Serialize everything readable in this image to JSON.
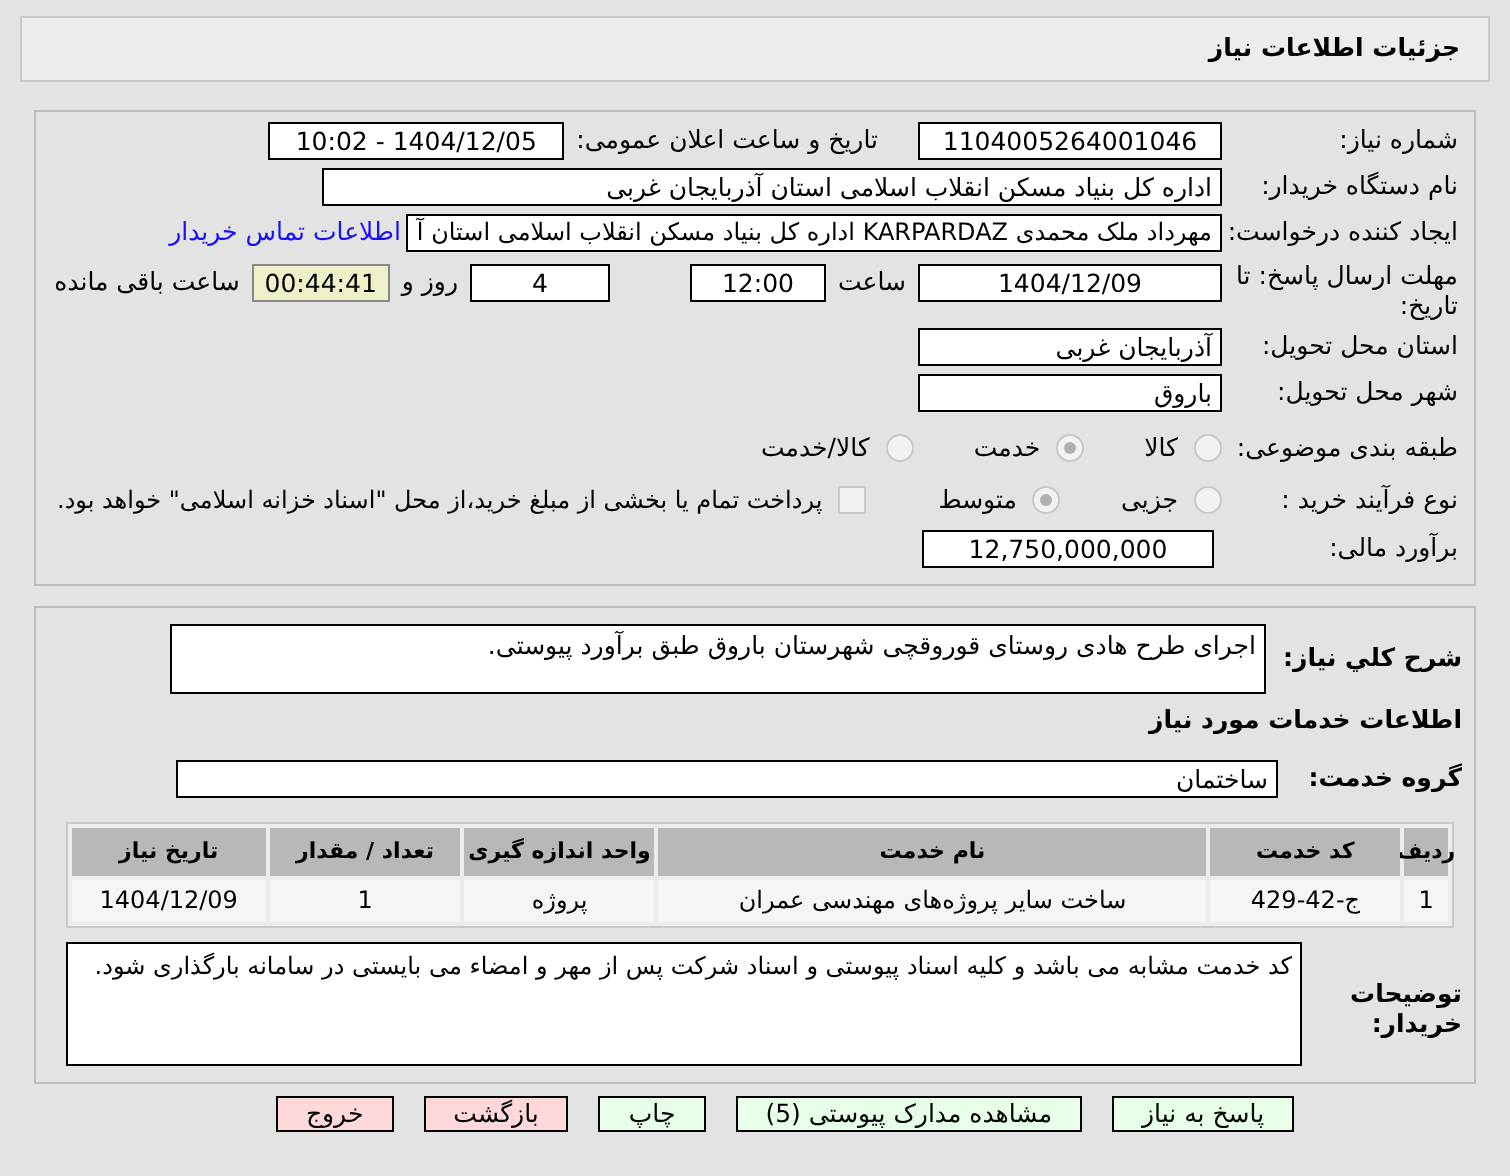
{
  "header": {
    "title": "جزئیات اطلاعات نیاز"
  },
  "fields": {
    "need_number": {
      "label": "شماره نیاز:",
      "value": "1104005264001046"
    },
    "announce": {
      "label": "تاریخ و ساعت اعلان عمومی:",
      "value": "1404/12/05 - 10:02"
    },
    "buyer": {
      "label": "نام دستگاه خریدار:",
      "value": "اداره کل بنیاد مسکن انقلاب اسلامی استان آذربایجان غربی"
    },
    "creator": {
      "label": "ایجاد کننده درخواست:",
      "value": "مهرداد ملک محمدی KARPARDAZ اداره کل بنیاد مسکن انقلاب اسلامی استان آ",
      "link": "اطلاعات تماس خریدار"
    },
    "deadline": {
      "label": "مهلت ارسال پاسخ: تا تاریخ:",
      "date": "1404/12/09",
      "time_label": "ساعت",
      "time": "12:00",
      "days": "4",
      "days_label": "روز و",
      "remaining": "00:44:41",
      "remaining_label": "ساعت باقی مانده"
    },
    "province": {
      "label": "استان محل تحویل:",
      "value": "آذربایجان غربی"
    },
    "city": {
      "label": "شهر محل تحویل:",
      "value": "باروق"
    },
    "category": {
      "label": "طبقه بندی موضوعی:",
      "options": [
        {
          "label": "کالا",
          "selected": false
        },
        {
          "label": "خدمت",
          "selected": true
        },
        {
          "label": "کالا/خدمت",
          "selected": false
        }
      ]
    },
    "process": {
      "label": "نوع فرآیند خرید :",
      "options": [
        {
          "label": "جزیی",
          "selected": false
        },
        {
          "label": "متوسط",
          "selected": true
        }
      ],
      "payment": {
        "label": "پرداخت تمام یا بخشی از مبلغ خرید،از محل \"اسناد خزانه اسلامی\" خواهد بود.",
        "checked": false
      }
    },
    "budget": {
      "label": "برآورد مالی:",
      "value": "12,750,000,000"
    }
  },
  "description": {
    "label": "شرح کلي نياز:",
    "value": "اجرای طرح هادی روستای قوروقچی شهرستان باروق طبق برآورد پیوستی."
  },
  "services": {
    "title": "اطلاعات خدمات مورد نیاز",
    "group_label": "گروه خدمت:",
    "group": "ساختمان",
    "columns": [
      "ردیف",
      "کد خدمت",
      "نام خدمت",
      "واحد اندازه گیری",
      "تعداد / مقدار",
      "تاریخ نیاز"
    ],
    "rows": [
      [
        "1",
        "ج-42-429",
        "ساخت سایر پروژه‌های مهندسی عمران",
        "پروژه",
        "1",
        "1404/12/09"
      ]
    ]
  },
  "notes": {
    "label": "توضیحات خریدار:",
    "value": "کد خدمت مشابه می باشد و کلیه اسناد پیوستی و اسناد شرکت پس از مهر و امضاء می بایستی در سامانه بارگذاری شود."
  },
  "buttons": [
    {
      "label": "پاسخ به نیاز",
      "kind": "green"
    },
    {
      "label": "مشاهده مدارک پیوستی (5)",
      "kind": "green"
    },
    {
      "label": "چاپ",
      "kind": "green"
    },
    {
      "label": "بازگشت",
      "kind": "red"
    },
    {
      "label": "خروج",
      "kind": "red"
    }
  ]
}
